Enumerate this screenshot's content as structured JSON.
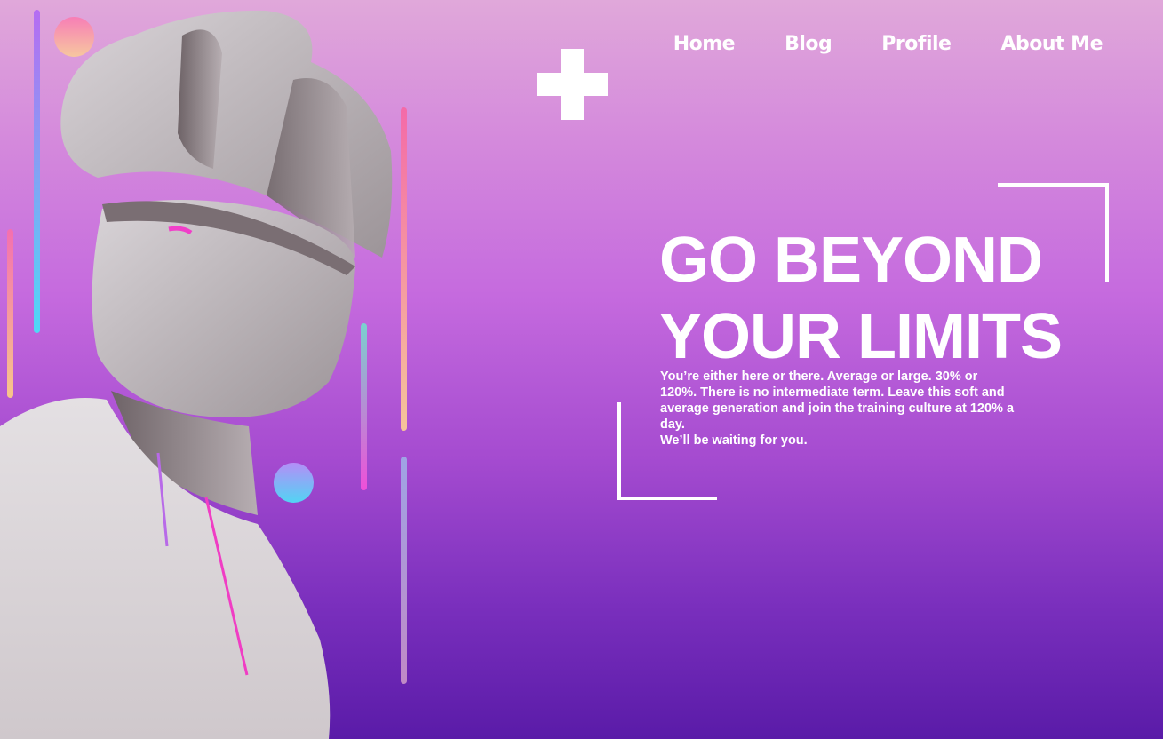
{
  "nav": {
    "items": [
      {
        "label": "Home"
      },
      {
        "label": "Blog"
      },
      {
        "label": "Profile"
      },
      {
        "label": "About Me"
      }
    ]
  },
  "hero": {
    "headline_line1": "GO BEYOND",
    "headline_line2": "YOUR LIMITS",
    "description": "You’re either here or there. Average or large. 30% or 120%. There is no intermediate term. Leave this soft and average generation and join the training culture at 120% a day.",
    "tagline": "We’ll be waiting for you."
  },
  "decor": {
    "icons": [
      "plus-icon",
      "statue-illustration"
    ],
    "colors": {
      "gradient_top": "#e0a8da",
      "gradient_mid": "#c56ade",
      "gradient_bottom": "#5a1ba8",
      "text": "#ffffff"
    }
  }
}
